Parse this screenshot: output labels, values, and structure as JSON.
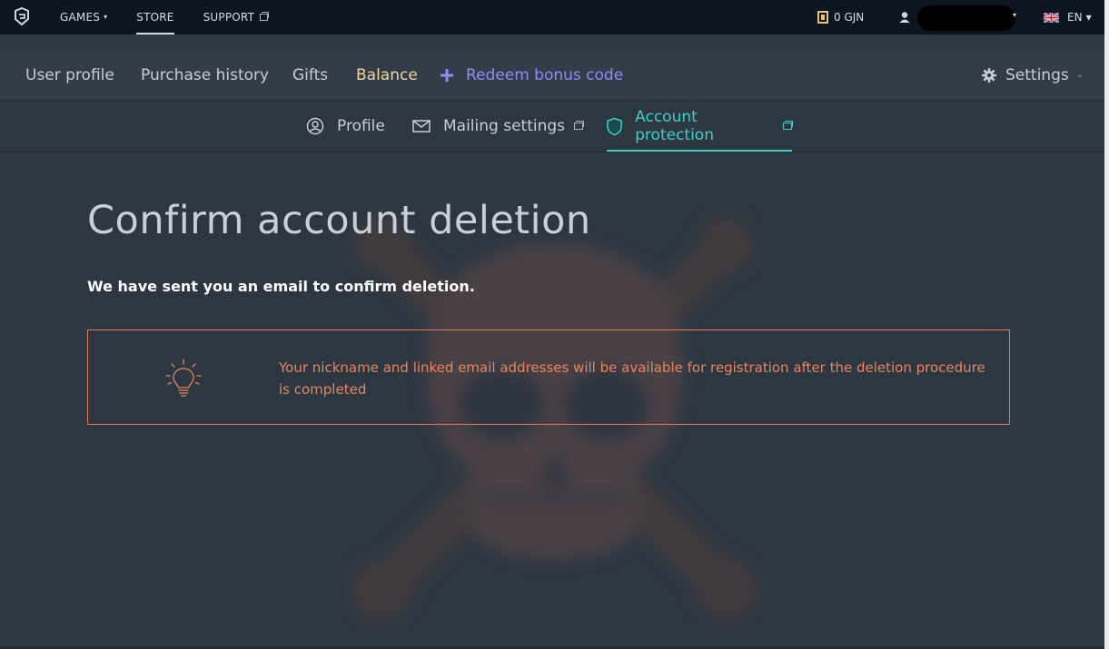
{
  "topbar": {
    "nav": [
      {
        "label": "GAMES",
        "caret": "▾"
      },
      {
        "label": "STORE"
      },
      {
        "label": "SUPPORT"
      }
    ],
    "balance": "0 GJN",
    "user_caret": "▾",
    "language": "EN",
    "language_caret": "▾"
  },
  "subnav": {
    "user_profile": "User profile",
    "purchase_history": "Purchase history",
    "gifts": "Gifts",
    "balance": "Balance",
    "redeem": "Redeem bonus code",
    "settings": "Settings",
    "settings_caret": "⌄"
  },
  "tabs": {
    "profile": "Profile",
    "mailing": "Mailing settings",
    "protection": "Account protection"
  },
  "main": {
    "title": "Confirm account deletion",
    "sent_message": "We have sent you an email to confirm deletion.",
    "notice": "Your nickname and linked email addresses will be available for registration after the deletion procedure is completed"
  },
  "colors": {
    "background": "#2d3742",
    "topbar": "#0c1520",
    "accent_teal": "#3ed0c6",
    "balance_gold": "#f2d39c",
    "redeem_purple": "#8a8df7",
    "notice_orange": "#e8855e"
  },
  "icons": [
    "app-logo-icon",
    "coin-icon",
    "user-icon",
    "uk-flag-icon",
    "plus-icon",
    "gear-icon",
    "profile-icon",
    "mail-icon",
    "shield-icon",
    "external-link-icon",
    "lightbulb-icon",
    "skull-background"
  ]
}
